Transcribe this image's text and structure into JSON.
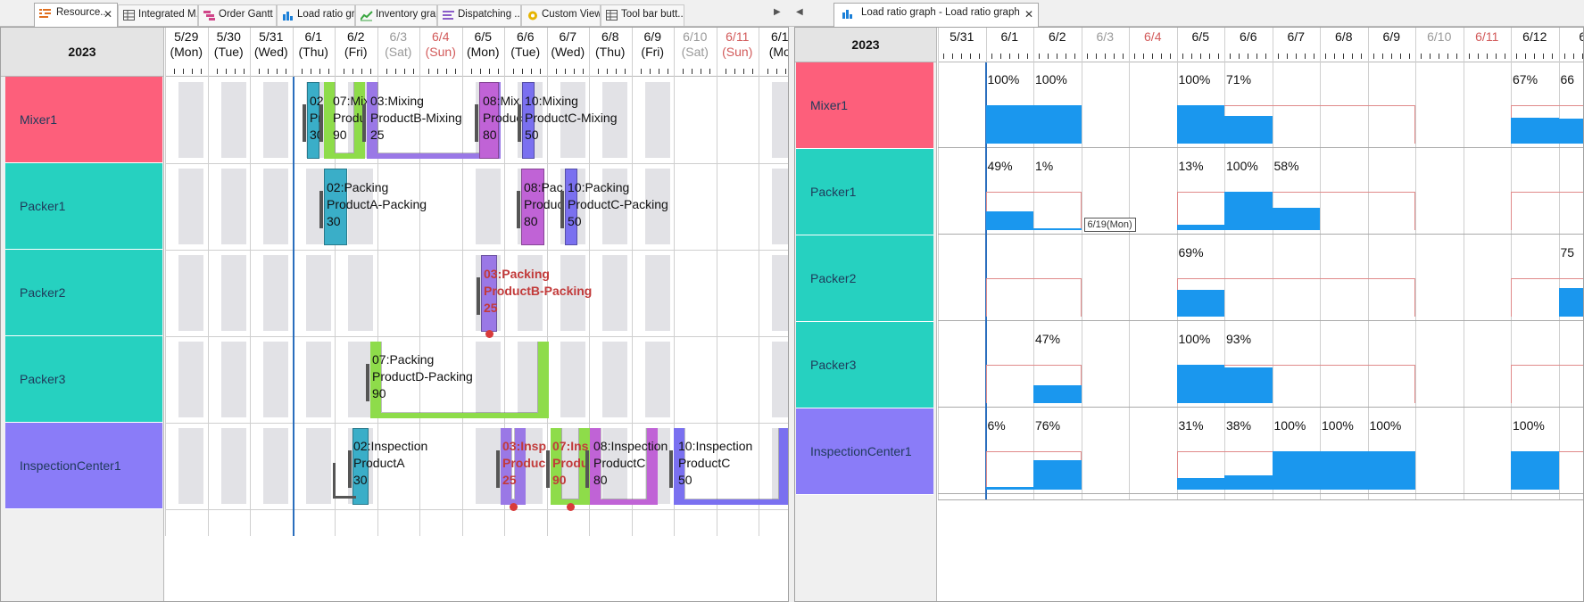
{
  "tabs_left": [
    {
      "label": "Resource...",
      "icon": "resource-gantt-icon",
      "active": true
    },
    {
      "label": "Integrated M...",
      "icon": "table-icon"
    },
    {
      "label": "Order Gantt ...",
      "icon": "order-gantt-icon"
    },
    {
      "label": "Load ratio gr...",
      "icon": "load-chart-icon"
    },
    {
      "label": "Inventory graph",
      "icon": "inventory-chart-icon"
    },
    {
      "label": "Dispatching ...",
      "icon": "dispatch-icon"
    },
    {
      "label": "Custom View...",
      "icon": "custom-view-icon"
    },
    {
      "label": "Tool bar butt...",
      "icon": "table-icon"
    }
  ],
  "tab_right": {
    "label": "Load ratio graph - Load ratio graph",
    "icon": "load-chart-icon"
  },
  "year": "2023",
  "resources": [
    {
      "name": "Mixer1",
      "color": "#fd5f7b"
    },
    {
      "name": "Packer1",
      "color": "#26d1c0"
    },
    {
      "name": "Packer2",
      "color": "#26d1c0"
    },
    {
      "name": "Packer3",
      "color": "#26d1c0"
    },
    {
      "name": "InspectionCenter1",
      "color": "#8a7cf8"
    }
  ],
  "left_dates": [
    {
      "d": "5/29",
      "w": "(Mon)",
      "kind": "wd"
    },
    {
      "d": "5/30",
      "w": "(Tue)",
      "kind": "wd"
    },
    {
      "d": "5/31",
      "w": "(Wed)",
      "kind": "wd"
    },
    {
      "d": "6/1",
      "w": "(Thu)",
      "kind": "wd"
    },
    {
      "d": "6/2",
      "w": "(Fri)",
      "kind": "wd"
    },
    {
      "d": "6/3",
      "w": "(Sat)",
      "kind": "sat"
    },
    {
      "d": "6/4",
      "w": "(Sun)",
      "kind": "sun"
    },
    {
      "d": "6/5",
      "w": "(Mon)",
      "kind": "wd"
    },
    {
      "d": "6/6",
      "w": "(Tue)",
      "kind": "wd"
    },
    {
      "d": "6/7",
      "w": "(Wed)",
      "kind": "wd"
    },
    {
      "d": "6/8",
      "w": "(Thu)",
      "kind": "wd"
    },
    {
      "d": "6/9",
      "w": "(Fri)",
      "kind": "wd"
    },
    {
      "d": "6/10",
      "w": "(Sat)",
      "kind": "sat"
    },
    {
      "d": "6/11",
      "w": "(Sun)",
      "kind": "sun"
    },
    {
      "d": "6/1",
      "w": "(Mo",
      "kind": "wd"
    }
  ],
  "right_dates": [
    {
      "d": "5/31",
      "kind": "wd"
    },
    {
      "d": "6/1",
      "kind": "wd"
    },
    {
      "d": "6/2",
      "kind": "wd"
    },
    {
      "d": "6/3",
      "kind": "sat"
    },
    {
      "d": "6/4",
      "kind": "sun"
    },
    {
      "d": "6/5",
      "kind": "wd"
    },
    {
      "d": "6/6",
      "kind": "wd"
    },
    {
      "d": "6/7",
      "kind": "wd"
    },
    {
      "d": "6/8",
      "kind": "wd"
    },
    {
      "d": "6/9",
      "kind": "wd"
    },
    {
      "d": "6/10",
      "kind": "sat"
    },
    {
      "d": "6/11",
      "kind": "sun"
    },
    {
      "d": "6/12",
      "kind": "wd"
    },
    {
      "d": "6",
      "kind": "wd"
    }
  ],
  "operations": [
    {
      "row": 0,
      "lines": [
        "02:",
        "Pr",
        "30"
      ],
      "color": "#3aaec8"
    },
    {
      "row": 0,
      "lines": [
        "07:Mix",
        "Product",
        "90"
      ],
      "color": "#8edc4a"
    },
    {
      "row": 0,
      "lines": [
        "03:Mixing",
        "ProductB-Mixing",
        "25"
      ],
      "color": "#9a78e6"
    },
    {
      "row": 0,
      "lines": [
        "08:Mix",
        "Produc",
        "80"
      ],
      "color": "#c063d6"
    },
    {
      "row": 0,
      "lines": [
        "10:Mixing",
        "ProductC-Mixing",
        "50"
      ],
      "color": "#7a70f0"
    },
    {
      "row": 1,
      "lines": [
        "02:Packing",
        "ProductA-Packing",
        "30"
      ],
      "color": "#3aaec8"
    },
    {
      "row": 1,
      "lines": [
        "08:Pac",
        "Produc",
        "80"
      ],
      "color": "#c063d6"
    },
    {
      "row": 1,
      "lines": [
        "10:Packing",
        "ProductC-Packing",
        "50"
      ],
      "color": "#7a70f0"
    },
    {
      "row": 2,
      "lines": [
        "03:Packing",
        "ProductB-Packing",
        "25"
      ],
      "color": "#9a78e6",
      "late": true
    },
    {
      "row": 3,
      "lines": [
        "07:Packing",
        "ProductD-Packing",
        "90"
      ],
      "color": "#8edc4a"
    },
    {
      "row": 4,
      "lines": [
        "02:Inspection",
        "ProductA",
        "30"
      ],
      "color": "#3aaec8"
    },
    {
      "row": 4,
      "lines": [
        "03:Insp",
        "Produc",
        "25"
      ],
      "color": "#9a78e6",
      "late": true
    },
    {
      "row": 4,
      "lines": [
        "07:Ins",
        "Produ",
        "90"
      ],
      "color": "#8edc4a",
      "late": true
    },
    {
      "row": 4,
      "lines": [
        "08:Inspection",
        "ProductC",
        "80"
      ],
      "color": "#c063d6"
    },
    {
      "row": 4,
      "lines": [
        "10:Inspection",
        "ProductC",
        "50"
      ],
      "color": "#7a70f0"
    }
  ],
  "load_ratios": [
    {
      "row": 0,
      "day": 1,
      "label": "100%",
      "value": 1.0
    },
    {
      "row": 0,
      "day": 2,
      "label": "100%",
      "value": 1.0
    },
    {
      "row": 0,
      "day": 5,
      "label": "100%",
      "value": 1.0
    },
    {
      "row": 0,
      "day": 6,
      "label": "71%",
      "value": 0.71
    },
    {
      "row": 0,
      "day": 12,
      "label": "67%",
      "value": 0.67
    },
    {
      "row": 0,
      "day": 13,
      "label": "66",
      "value": 0.66
    },
    {
      "row": 1,
      "day": 1,
      "label": "49%",
      "value": 0.49
    },
    {
      "row": 1,
      "day": 2,
      "label": "1%",
      "value": 0.01
    },
    {
      "row": 1,
      "day": 5,
      "label": "13%",
      "value": 0.13
    },
    {
      "row": 1,
      "day": 6,
      "label": "100%",
      "value": 1.0
    },
    {
      "row": 1,
      "day": 7,
      "label": "58%",
      "value": 0.58
    },
    {
      "row": 2,
      "day": 5,
      "label": "69%",
      "value": 0.69
    },
    {
      "row": 2,
      "day": 13,
      "label": "75",
      "value": 0.75
    },
    {
      "row": 3,
      "day": 2,
      "label": "47%",
      "value": 0.47
    },
    {
      "row": 3,
      "day": 5,
      "label": "100%",
      "value": 1.0
    },
    {
      "row": 3,
      "day": 6,
      "label": "93%",
      "value": 0.93
    },
    {
      "row": 4,
      "day": 1,
      "label": "6%",
      "value": 0.06
    },
    {
      "row": 4,
      "day": 2,
      "label": "76%",
      "value": 0.76
    },
    {
      "row": 4,
      "day": 5,
      "label": "31%",
      "value": 0.31
    },
    {
      "row": 4,
      "day": 6,
      "label": "38%",
      "value": 0.38
    },
    {
      "row": 4,
      "day": 7,
      "label": "100%",
      "value": 1.0
    },
    {
      "row": 4,
      "day": 8,
      "label": "100%",
      "value": 1.0
    },
    {
      "row": 4,
      "day": 9,
      "label": "100%",
      "value": 1.0
    },
    {
      "row": 4,
      "day": 12,
      "label": "100%",
      "value": 1.0
    }
  ],
  "tooltip": "6/19(Mon)",
  "colors": {
    "weekend_sat": "#999999",
    "weekend_sun": "#d25a5a",
    "load_bar": "#1a97ee",
    "capacity_line": "#e08a8a",
    "late_mark": "#d83b3b"
  }
}
